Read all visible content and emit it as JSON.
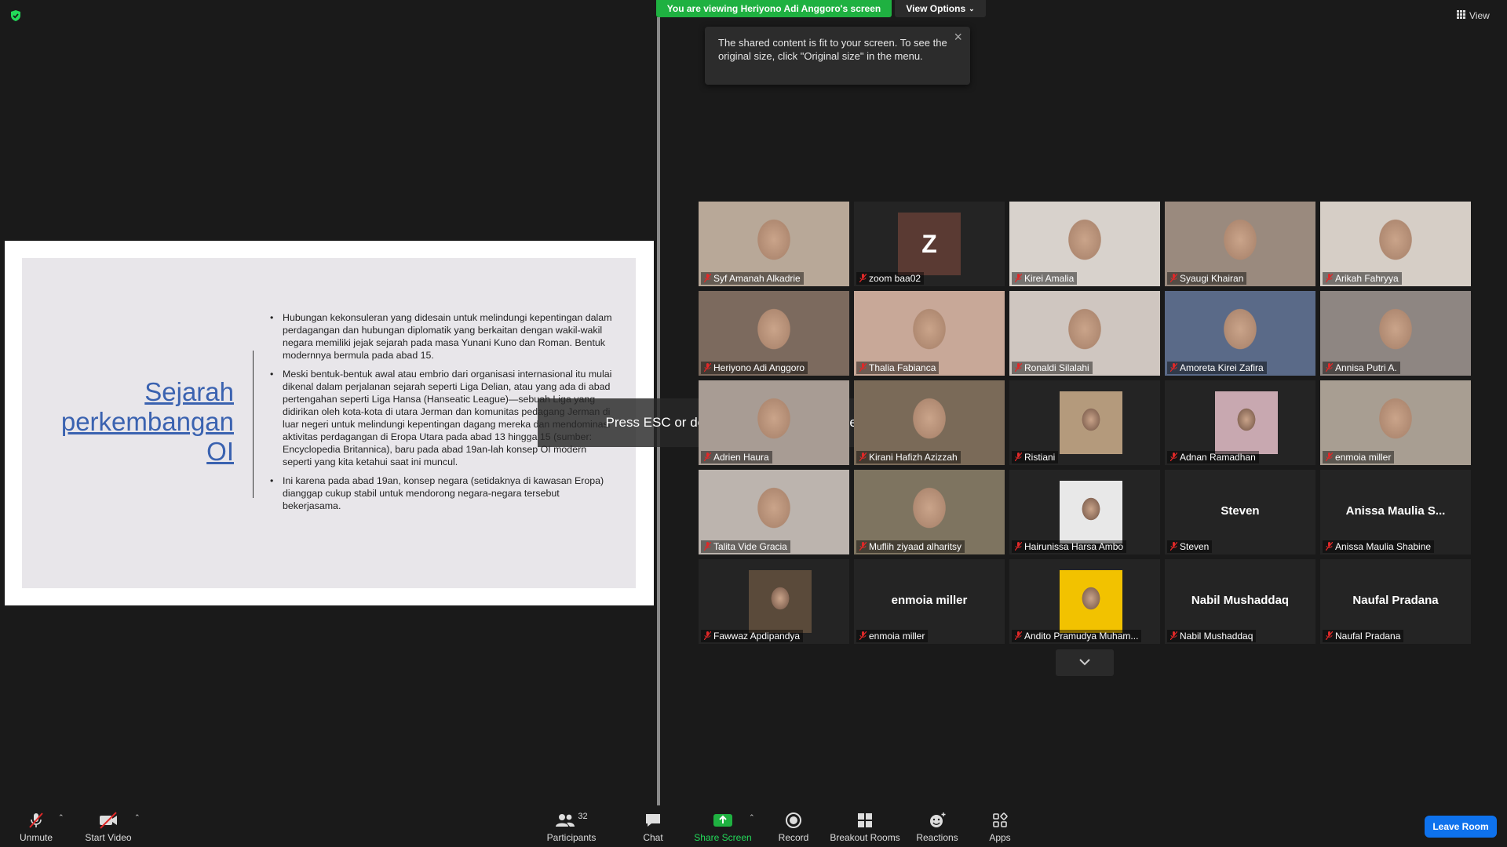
{
  "banner": {
    "viewing": "You are viewing Heriyono Adi Anggoro's screen",
    "view_options": "View Options",
    "view": "View"
  },
  "tooltip": {
    "text": "The shared content is fit to your screen. To see the original size, click \"Original size\" in the menu."
  },
  "esc_notice": "Press ESC or double-click to exit full screen mode",
  "slide": {
    "title_lines": [
      "Sejarah",
      "perkembangan",
      "OI"
    ],
    "bullets": [
      "Hubungan kekonsuleran yang didesain untuk melindungi kepentingan dalam perdagangan dan hubungan diplomatik yang berkaitan dengan wakil-wakil negara memiliki jejak sejarah pada masa Yunani Kuno dan Roman. Bentuk modernnya bermula pada abad 15.",
      "Meski bentuk-bentuk awal atau embrio dari organisasi internasional itu mulai dikenal dalam perjalanan sejarah seperti Liga Delian, atau yang ada di abad pertengahan seperti Liga Hansa (Hanseatic League)—sebuah Liga yang didirikan oleh kota-kota di utara Jerman dan komunitas pedagang Jerman di luar negeri untuk melindungi kepentingan dagang mereka dan mendominasi aktivitas perdagangan di Eropa Utara pada abad 13 hingga 15 (sumber: Encyclopedia Britannica), baru pada abad 19an-lah konsep OI modern seperti yang kita ketahui saat ini muncul.",
      "Ini karena pada abad 19an, konsep negara (setidaknya di kawasan Eropa) dianggap cukup stabil untuk mendorong negara-negara tersebut bekerjasama."
    ]
  },
  "participants": [
    {
      "name": "Syf Amanah Alkadrie",
      "kind": "video",
      "bg": "#b8a898"
    },
    {
      "name": "zoom baa02",
      "kind": "initial",
      "initial": "Z"
    },
    {
      "name": "Kirei Amalia",
      "kind": "video",
      "bg": "#d8d2cc"
    },
    {
      "name": "Syaugi Khairan",
      "kind": "video",
      "bg": "#9a8a7e"
    },
    {
      "name": "Arikah Fahryya",
      "kind": "video",
      "bg": "#d6cec6"
    },
    {
      "name": "Heriyono Adi Anggoro",
      "kind": "video",
      "bg": "#7c6a5e",
      "active": true
    },
    {
      "name": "Thalia Fabianca",
      "kind": "video",
      "bg": "#c8a898"
    },
    {
      "name": "Ronaldi Silalahi",
      "kind": "video",
      "bg": "#cfc6c0"
    },
    {
      "name": "Amoreta Kirei Zafira",
      "kind": "video",
      "bg": "#5a6a88"
    },
    {
      "name": "Annisa Putri A.",
      "kind": "video",
      "bg": "#8e8682"
    },
    {
      "name": "Adrien Haura",
      "kind": "video",
      "bg": "#a89c94"
    },
    {
      "name": "Kirani Hafizh Azizzah",
      "kind": "video",
      "bg": "#7a6a58"
    },
    {
      "name": "Ristiani",
      "kind": "photo",
      "bg": "#b49a7c"
    },
    {
      "name": "Adnan Ramadhan",
      "kind": "photo",
      "bg": "#c8a8b0"
    },
    {
      "name": "enmoia miller",
      "kind": "video",
      "bg": "#a89e92"
    },
    {
      "name": "Talita Vide Gracia",
      "kind": "video",
      "bg": "#bcb4ae"
    },
    {
      "name": "Muflih ziyaad alharitsy",
      "kind": "video",
      "bg": "#7e7460"
    },
    {
      "name": "Hairunissa Harsa Ambo",
      "kind": "photo",
      "bg": "#e8e8e8"
    },
    {
      "name": "Steven",
      "kind": "name",
      "display": "Steven"
    },
    {
      "name": "Anissa Maulia Shabine",
      "kind": "name",
      "display": "Anissa Maulia S..."
    },
    {
      "name": "Fawwaz Apdipandya",
      "kind": "photo",
      "bg": "#5a4a3a"
    },
    {
      "name": "enmoia miller",
      "kind": "name",
      "display": "enmoia miller"
    },
    {
      "name": "Andito Pramudya Muham...",
      "kind": "photo",
      "bg": "#f2c200"
    },
    {
      "name": "Nabil Mushaddaq",
      "kind": "name",
      "display": "Nabil Mushaddaq"
    },
    {
      "name": "Naufal Pradana",
      "kind": "name",
      "display": "Naufal Pradana"
    }
  ],
  "toolbar": {
    "unmute": "Unmute",
    "start_video": "Start Video",
    "participants": "Participants",
    "participants_count": "32",
    "chat": "Chat",
    "share_screen": "Share Screen",
    "record": "Record",
    "breakout_rooms": "Breakout Rooms",
    "reactions": "Reactions",
    "apps": "Apps",
    "leave_room": "Leave Room"
  },
  "colors": {
    "banner_green": "#1fb141",
    "active_speaker": "#c9e04f",
    "leave_blue": "#0e72ed",
    "mute_red": "#e02828"
  }
}
